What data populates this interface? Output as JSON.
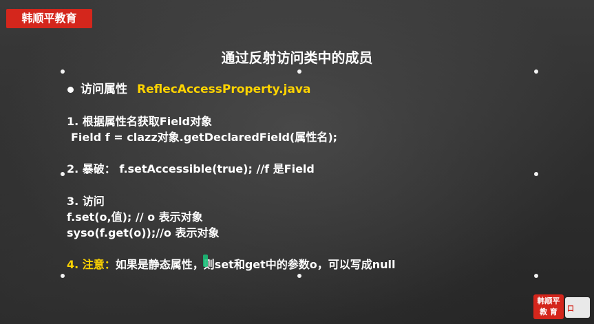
{
  "brand": {
    "name": "韩顺平教育"
  },
  "slide": {
    "title": "通过反射访问类中的成员",
    "section": {
      "label": "访问属性",
      "file": "ReflecAccessProperty.java"
    },
    "steps": [
      {
        "line1": "1.  根据属性名获取Field对象",
        "line2": "Field f = clazz对象.getDeclaredField(属性名);"
      },
      {
        "line1": "2.  暴破：  f.setAccessible(true); //f 是Field"
      },
      {
        "line1": "3.  访问",
        "line2": "f.set(o,值); // o 表示对象",
        "line3": "syso(f.get(o));//o 表示对象"
      },
      {
        "label": "4.  注意：",
        "text": "如果是静态属性，则set和get中的参数o，可以写成null"
      }
    ]
  },
  "logo": {
    "line1": "韩顺平",
    "line2": "教  育",
    "side": "口"
  },
  "colors": {
    "brand_red": "#d4261c",
    "highlight_yellow": "#ffd400",
    "text": "#ffffff"
  }
}
